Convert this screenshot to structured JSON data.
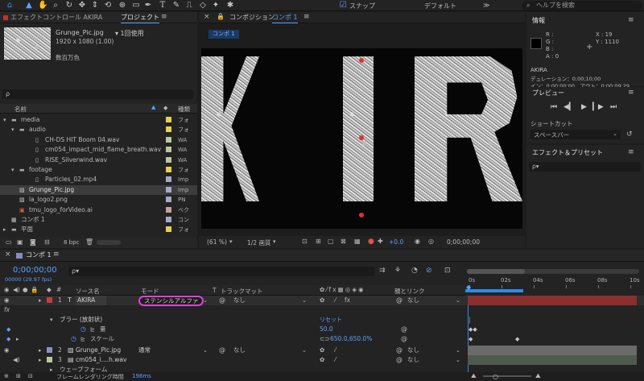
{
  "toolbar": {
    "snap_label": "スナップ",
    "workspace_label": "デフォルト",
    "help_placeholder": "ヘルプを検索"
  },
  "effect_controls_tab": "エフェクトコントロール AKIRA",
  "project": {
    "tab": "プロジェクト",
    "preview_name": "Grunge_Pic.jpg",
    "preview_usage": "▾ 1回使用",
    "preview_dims": "1920 x 1080 (1.00)",
    "preview_color": "数百万色",
    "col_name": "名前",
    "col_type": "種類",
    "items": [
      {
        "name": "media",
        "type": "フォ",
        "kind": "folder",
        "indent": 0,
        "color": "#e6d24a",
        "open": true
      },
      {
        "name": "audio",
        "type": "フォ",
        "kind": "folder",
        "indent": 1,
        "color": "#e6d24a",
        "open": true
      },
      {
        "name": "CH-DS HIT Boom 04.wav",
        "type": "WA",
        "kind": "file",
        "indent": 3,
        "color": "#b8c8a0"
      },
      {
        "name": "cm054_impact_mid_flame_breath.wav",
        "type": "WA",
        "kind": "file",
        "indent": 3,
        "color": "#b8c8a0"
      },
      {
        "name": "RISE_Silverwind.wav",
        "type": "WA",
        "kind": "file",
        "indent": 3,
        "color": "#b8c8a0"
      },
      {
        "name": "footage",
        "type": "フォ",
        "kind": "folder",
        "indent": 1,
        "color": "#e6d24a",
        "open": true
      },
      {
        "name": "Particles_02.mp4",
        "type": "Imp",
        "kind": "file",
        "indent": 3,
        "color": "#a8a8c8"
      },
      {
        "name": "Grunge_Pic.jpg",
        "type": "Imp",
        "kind": "image",
        "indent": 1,
        "color": "#a8a8c8",
        "selected": true
      },
      {
        "name": "la_logo2.png",
        "type": "PN",
        "kind": "image",
        "indent": 1,
        "color": "#a8a8c8"
      },
      {
        "name": "tmu_logo_forVideo.ai",
        "type": "ベク",
        "kind": "ai",
        "indent": 1,
        "color": "#c8a0a0"
      },
      {
        "name": "コンポ 1",
        "type": "コン",
        "kind": "comp",
        "indent": 0,
        "color": "#a8a8c8"
      },
      {
        "name": "平面",
        "type": "フォ",
        "kind": "folder",
        "indent": 0,
        "color": "#e6d24a",
        "open": false
      }
    ],
    "bpc": "8 bpc"
  },
  "composition": {
    "tab_prefix": "コンポジション",
    "tab_name": "コンポ 1",
    "sub_tab": "コンポ 1",
    "letters": [
      "K",
      "I",
      "R"
    ],
    "zoom": "(61 %)",
    "resolution": "1/2 画質",
    "exposure": "+0.0",
    "timecode": "0;00;00;00"
  },
  "info": {
    "tab": "情報",
    "r": "R :",
    "g": "G :",
    "b": "B :",
    "a": "A : 0",
    "x": "X : 19",
    "y": "Y : 1110",
    "layer": "AKIRA",
    "duration": "デュレーション：0;00;10;00",
    "inout": "イン：0;00;00;00、アウト：0;00;09;29"
  },
  "preview": {
    "tab": "プレビュー",
    "shortcut_label": "ショートカット",
    "shortcut_value": "スペースバー"
  },
  "effects": {
    "tab": "エフェクト＆プリセット",
    "search_placeholder": "ρ▾"
  },
  "timeline": {
    "tab": "コンポ 1",
    "timecode": "0;00;00;00",
    "frames": "00000 (29.97 fps)",
    "col_source": "ソース名",
    "col_mode": "モード",
    "col_t": "T",
    "col_trackmatte": "トラックマット",
    "col_parent": "親とリンク",
    "ruler": [
      "0s",
      "02s",
      "04s",
      "06s",
      "08s",
      "10s"
    ],
    "layers": [
      {
        "num": "1",
        "name": "AKIRA",
        "mode": "ステンシルアルファ",
        "matte": "なし",
        "parent": "なし",
        "label": "#c04040",
        "kind": "T"
      },
      {
        "num": "2",
        "name": "Grunge_Pic.jpg",
        "mode": "通常",
        "matte": "なし",
        "parent": "なし",
        "label": "#9090c0",
        "kind": "img"
      },
      {
        "num": "3",
        "name": "cm054_i....h.wav",
        "mode": "",
        "matte": "",
        "parent": "なし",
        "label": "#b8c8a0",
        "kind": "audio"
      }
    ],
    "props": {
      "blur": "ブラー (放射状)",
      "reset": "リセット",
      "amount_label": "量",
      "amount_value": "50.0",
      "scale_label": "スケール",
      "scale_value": "650.0,650.0%",
      "waveform": "ウェーブフォーム"
    },
    "render_label": "フレームレンダリング時間",
    "render_value": "198ms"
  },
  "colors": {
    "accent": "#2d8ceb",
    "highlight_circle": "#e040e0",
    "layer_bar_red": "#8a2e2e",
    "layer_bar_gray": "#6a6a6a"
  }
}
